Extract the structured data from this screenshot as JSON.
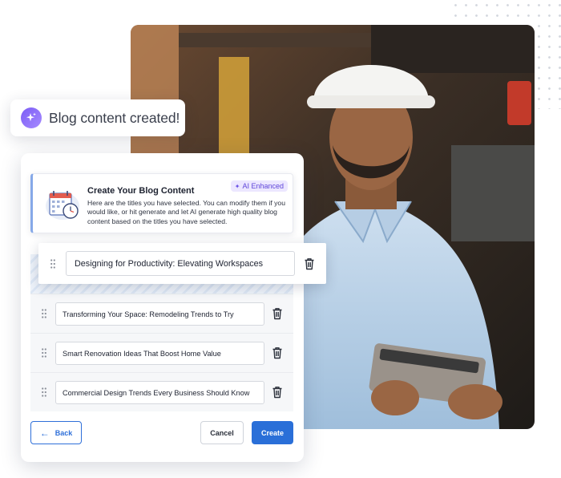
{
  "toast": {
    "text": "Blog content created!",
    "icon": "sparkle-icon"
  },
  "info": {
    "title": "Create Your Blog Content",
    "badge": "AI Enhanced",
    "description": "Here are the titles you have selected. You can modify them if you would like, or hit generate  and let AI generate high quality blog content based on the titles you have selected."
  },
  "titles": {
    "dragging": "Designing for Productivity: Elevating Workspaces",
    "items": [
      "Transforming Your Space: Remodeling Trends to Try",
      "Smart Renovation Ideas That Boost Home Value",
      "Commercial Design Trends Every Business Should Know"
    ]
  },
  "buttons": {
    "back": "Back",
    "cancel": "Cancel",
    "create": "Create"
  },
  "colors": {
    "primary": "#2a6fd8",
    "accent": "#7b5cf5",
    "badge_bg": "#ece7ff"
  }
}
